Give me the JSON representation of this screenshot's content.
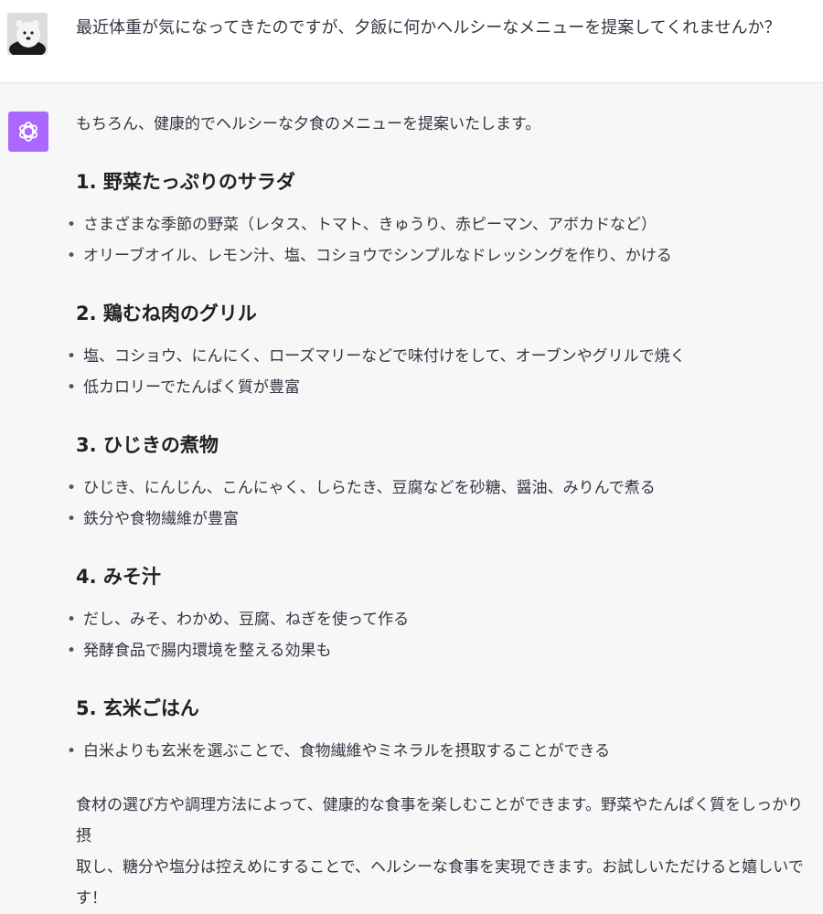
{
  "user_message": {
    "text": "最近体重が気になってきたのですが、夕飯に何かヘルシーなメニューを提案してくれませんか？"
  },
  "assistant_message": {
    "intro": "もちろん、健康的でヘルシーな夕食のメニューを提案いたします。",
    "sections": [
      {
        "heading": "1. 野菜たっぷりのサラダ",
        "bullets": [
          "さまざまな季節の野菜（レタス、トマト、きゅうり、赤ピーマン、アボカドなど）",
          "オリーブオイル、レモン汁、塩、コショウでシンプルなドレッシングを作り、かける"
        ]
      },
      {
        "heading": "2. 鶏むね肉のグリル",
        "bullets": [
          "塩、コショウ、にんにく、ローズマリーなどで味付けをして、オーブンやグリルで焼く",
          "低カロリーでたんぱく質が豊富"
        ]
      },
      {
        "heading": "3. ひじきの煮物",
        "bullets": [
          "ひじき、にんじん、こんにゃく、しらたき、豆腐などを砂糖、醤油、みりんで煮る",
          "鉄分や食物繊維が豊富"
        ]
      },
      {
        "heading": "4. みそ汁",
        "bullets": [
          "だし、みそ、わかめ、豆腐、ねぎを使って作る",
          "発酵食品で腸内環境を整える効果も"
        ]
      },
      {
        "heading": "5. 玄米ごはん",
        "bullets": [
          "白米よりも玄米を選ぶことで、食物繊維やミネラルを摂取することができる"
        ]
      }
    ],
    "closing_line1": "食材の選び方や調理方法によって、健康的な食事を楽しむことができます。野菜やたんぱく質をしっかり摂",
    "closing_line2": "取し、糖分や塩分は控えめにすることで、ヘルシーな食事を実現できます。お試しいただけると嬉しいです！"
  },
  "colors": {
    "user_background": "#ffffff",
    "assistant_background": "#f7f7f8",
    "assistant_avatar": "#ab68ff",
    "text": "#343541"
  },
  "icons": {
    "user_avatar": "polar-bear-avatar-icon",
    "assistant_avatar": "openai-logo-icon",
    "bullet": "bullet-dot-icon"
  }
}
